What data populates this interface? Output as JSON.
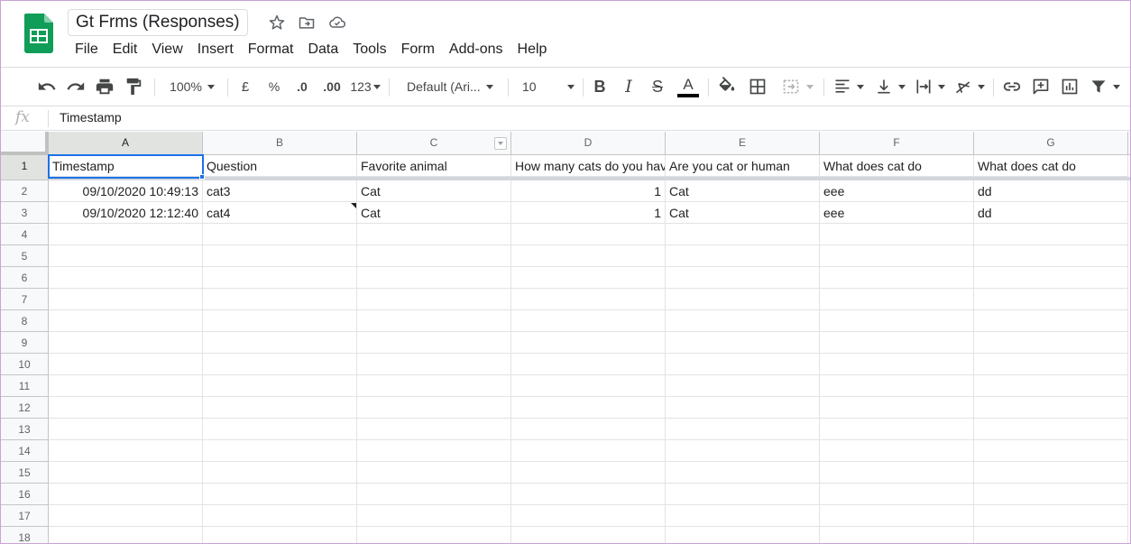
{
  "document": {
    "title": "Gt Frms (Responses)",
    "icons": [
      "star-icon",
      "move-to-folder-icon",
      "cloud-status-icon"
    ]
  },
  "menu": [
    "File",
    "Edit",
    "View",
    "Insert",
    "Format",
    "Data",
    "Tools",
    "Form",
    "Add-ons",
    "Help"
  ],
  "toolbar": {
    "zoom": "100%",
    "currency": "£",
    "percent": "%",
    "decimal_decrease": ".0",
    "decimal_increase": ".00",
    "more_formats": "123",
    "font": "Default (Ari...",
    "font_size": "10",
    "bold": "B",
    "italic": "I",
    "strikethrough": "S",
    "text_color": "A",
    "text_color_value": "#000000"
  },
  "formula_bar": {
    "fx_label": "fx",
    "value": "Timestamp"
  },
  "columns": [
    "A",
    "B",
    "C",
    "D",
    "E",
    "F",
    "G"
  ],
  "rows": [
    "1",
    "2",
    "3",
    "4",
    "5",
    "6",
    "7",
    "8",
    "9",
    "10",
    "11",
    "12",
    "13",
    "14",
    "15",
    "16",
    "17",
    "18"
  ],
  "cells": {
    "r1": [
      "Timestamp",
      "Question",
      "Favorite animal",
      "How many cats do you have",
      "Are you cat or human",
      "What does cat do",
      "What does cat do"
    ],
    "r2": [
      "09/10/2020 10:49:13",
      "cat3",
      "Cat",
      "1",
      "Cat",
      "eee",
      "dd"
    ],
    "r3": [
      "09/10/2020 12:12:40",
      "cat4",
      "Cat",
      "1",
      "Cat",
      "eee",
      "dd"
    ]
  },
  "colors": {
    "accent": "#1a73e8",
    "sheets_green": "#0f9d58",
    "header_bg": "#f8f9fa",
    "grid_line": "#e2e3e3"
  }
}
